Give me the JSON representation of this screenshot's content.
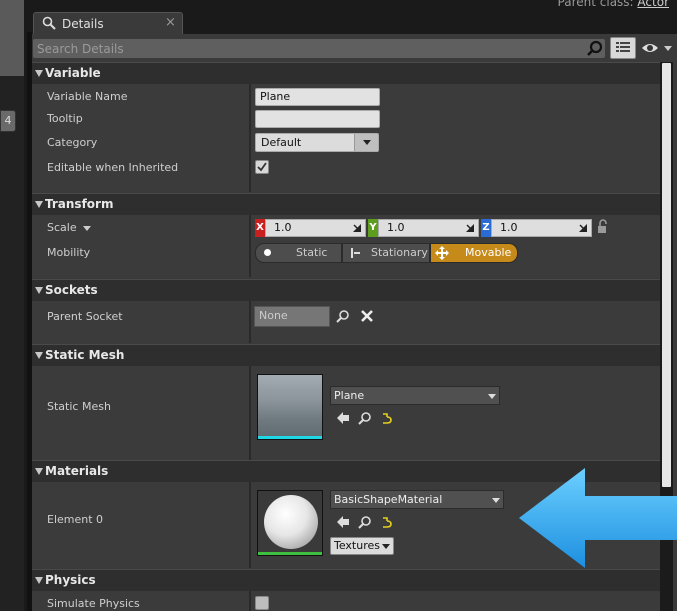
{
  "window": {
    "parent_class_label": "Parent class:",
    "parent_class_value": "Actor"
  },
  "tab": {
    "label": "Details",
    "close": "×"
  },
  "left_badge": "4",
  "search": {
    "placeholder": "Search Details",
    "value": ""
  },
  "categories": {
    "variable": {
      "title": "Variable",
      "props": {
        "variable_name": {
          "label": "Variable Name",
          "value": "Plane"
        },
        "tooltip": {
          "label": "Tooltip",
          "value": ""
        },
        "category": {
          "label": "Category",
          "value": "Default"
        },
        "editable_when_inherited": {
          "label": "Editable when Inherited",
          "checked": true
        }
      }
    },
    "transform": {
      "title": "Transform",
      "scale": {
        "label": "Scale",
        "x_label": "X",
        "y_label": "Y",
        "z_label": "Z",
        "x": "1.0",
        "y": "1.0",
        "z": "1.0"
      },
      "mobility": {
        "label": "Mobility",
        "options": [
          "Static",
          "Stationary",
          "Movable"
        ],
        "selected": "Movable"
      }
    },
    "sockets": {
      "title": "Sockets",
      "parent_socket": {
        "label": "Parent Socket",
        "value": "None"
      }
    },
    "static_mesh": {
      "title": "Static Mesh",
      "static_mesh": {
        "label": "Static Mesh",
        "asset": "Plane"
      }
    },
    "materials": {
      "title": "Materials",
      "element_0": {
        "label": "Element 0",
        "asset": "BasicShapeMaterial",
        "textures_label": "Textures"
      }
    },
    "physics": {
      "title": "Physics",
      "simulate_physics": {
        "label": "Simulate Physics",
        "checked": false
      }
    }
  },
  "colors": {
    "axis_x": "#c8201e",
    "axis_y": "#5e9e1e",
    "axis_z": "#2b6bd6",
    "movable_accent": "#c58a1a",
    "arrow_overlay": "#2ea8ee"
  },
  "icons": [
    "search-icon",
    "grid-view-icon",
    "eye-icon",
    "lock-icon",
    "browse-arrow-icon",
    "find-icon",
    "reset-icon",
    "clear-icon"
  ]
}
